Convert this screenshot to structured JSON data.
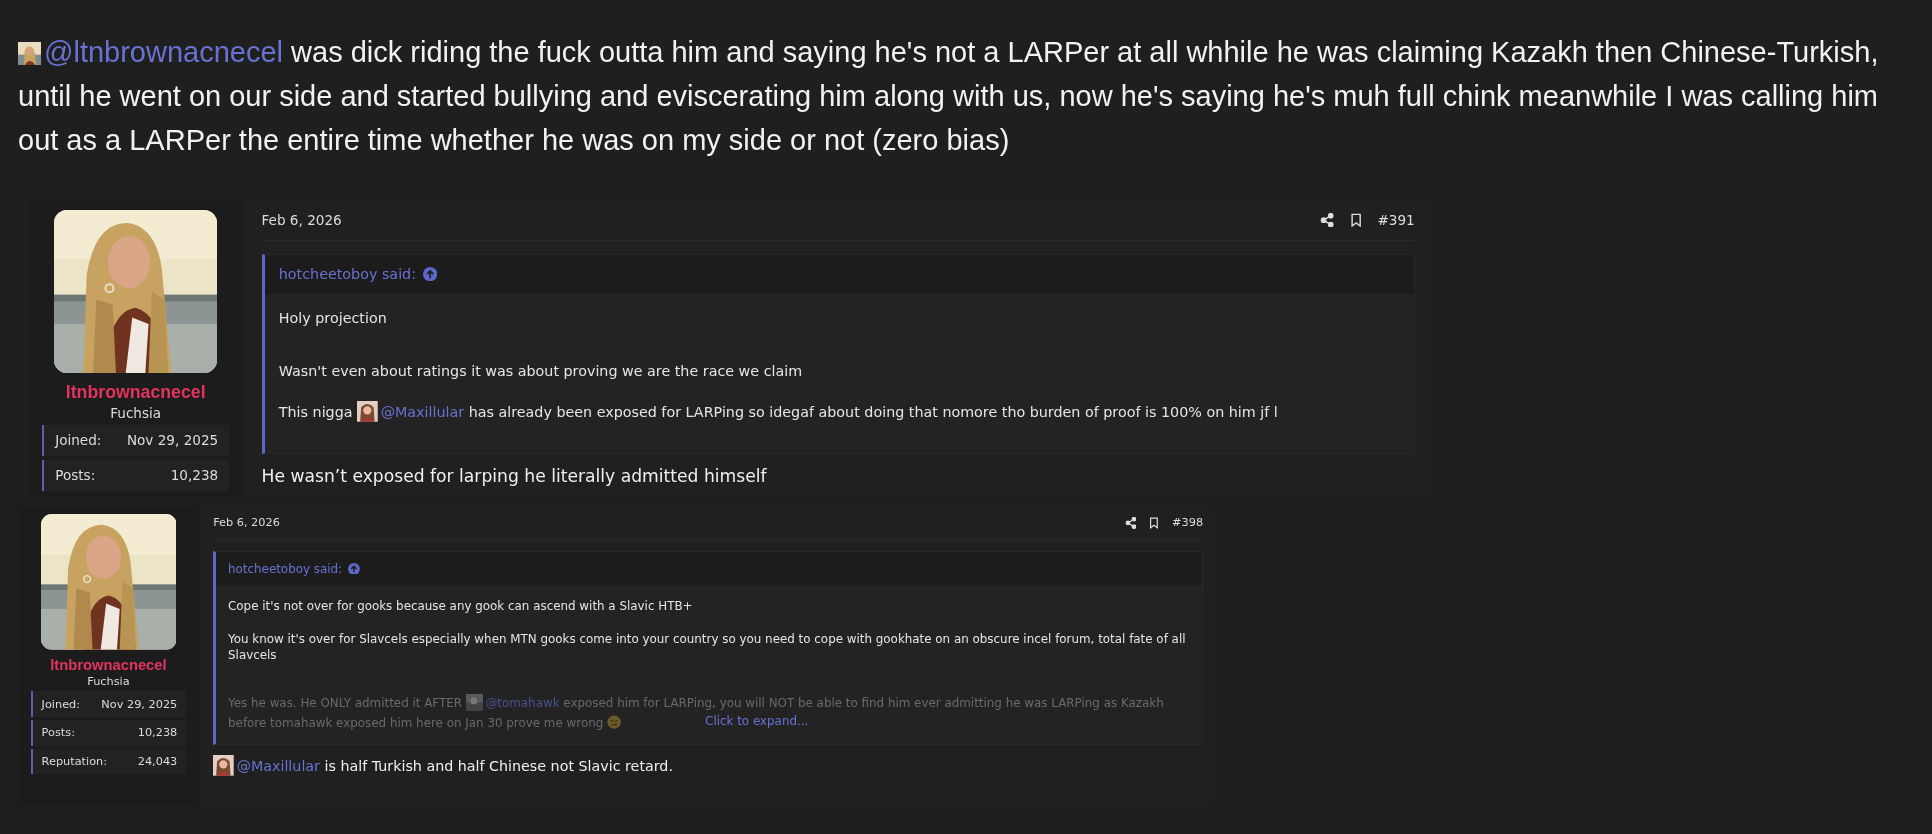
{
  "message": {
    "mention": "@ltnbrownacnecel",
    "text": " was dick riding the fuck outta him and saying he's not a LARPer at all whhile he was claiming Kazakh then Chinese-Turkish, until he went on our side and started bullying and eviscerating him along with us, now he's saying he's muh full chink meanwhile I was calling him out as a LARPer the entire time whether he was on my side or not (zero bias)"
  },
  "posts": [
    {
      "date": "Feb 6, 2026",
      "post_number": "#391",
      "author": {
        "name": "ltnbrownacnecel",
        "title": "Fuchsia",
        "stats": [
          {
            "label": "Joined:",
            "value": "Nov 29, 2025"
          },
          {
            "label": "Posts:",
            "value": "10,238"
          }
        ]
      },
      "quote": {
        "attribution": "hotcheetoboy said:",
        "paragraphs": [
          {
            "segments": [
              {
                "kind": "text",
                "text": "Holy projection"
              }
            ]
          },
          {
            "segments": [
              {
                "kind": "text",
                "text": "Wasn't even about ratings it was about proving we are the race we claim"
              }
            ]
          },
          {
            "segments": [
              {
                "kind": "text",
                "text": "This nigga "
              },
              {
                "kind": "mention",
                "text": "@Maxillular"
              },
              {
                "kind": "text",
                "text": " has already been exposed for LARPing so idegaf about doing that nomore tho burden of proof is 100% on him jf l"
              }
            ]
          }
        ]
      },
      "reply": [
        {
          "kind": "text",
          "text": "He wasn’t exposed for larping he literally admitted himself"
        }
      ]
    },
    {
      "date": "Feb 6, 2026",
      "post_number": "#398",
      "author": {
        "name": "ltnbrownacnecel",
        "title": "Fuchsia",
        "stats": [
          {
            "label": "Joined:",
            "value": "Nov 29, 2025"
          },
          {
            "label": "Posts:",
            "value": "10,238"
          },
          {
            "label": "Reputation:",
            "value": "24,043"
          }
        ]
      },
      "quote": {
        "attribution": "hotcheetoboy said:",
        "paragraphs": [
          {
            "segments": [
              {
                "kind": "text",
                "text": "Cope it's not over for gooks because any gook can ascend with a Slavic HTB+"
              }
            ]
          },
          {
            "segments": [
              {
                "kind": "text",
                "text": "You know it's over for Slavcels especially when MTN gooks come into your country so you need to cope with gookhate on an obscure incel forum, total fate of all Slavcels"
              }
            ]
          }
        ],
        "faded": [
          {
            "segments": [
              {
                "kind": "text",
                "text": "Yes he was. He ONLY admitted it AFTER "
              },
              {
                "kind": "mention",
                "text": "@tomahawk"
              },
              {
                "kind": "text",
                "text": " exposed him for LARPing, you will NOT be able to find him ever admitting he was LARPing as Kazakh"
              }
            ]
          },
          {
            "segments": [
              {
                "kind": "text",
                "text": "before tomahawk exposed him here on Jan 30 prove me wrong"
              },
              {
                "kind": "emoji"
              }
            ]
          }
        ],
        "expand_label": "Click to expand..."
      },
      "reply": [
        {
          "kind": "mention",
          "text": "@Maxillular"
        },
        {
          "kind": "text",
          "text": " is half Turkish and half Chinese not Slavic retard."
        }
      ]
    }
  ]
}
